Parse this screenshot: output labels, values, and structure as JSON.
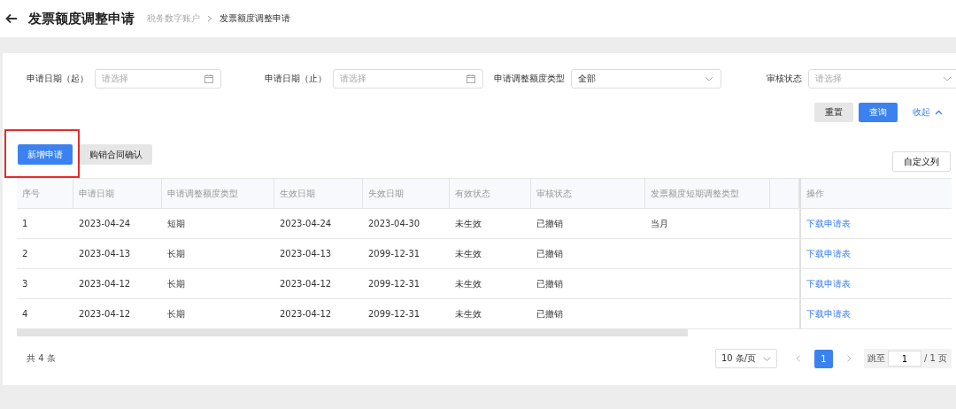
{
  "header": {
    "title": "发票额度调整申请",
    "breadcrumb": [
      {
        "label": "税务数字账户",
        "current": false
      },
      {
        "label": "发票额度调整申请",
        "current": true
      }
    ]
  },
  "filters": [
    {
      "kind": "date",
      "label": "申请日期（起）",
      "placeholder": "请选择"
    },
    {
      "kind": "date",
      "label": "申请日期（止）",
      "placeholder": "请选择"
    },
    {
      "kind": "select",
      "label": "申请调整额度类型",
      "value": "全部"
    },
    {
      "kind": "select",
      "label": "审核状态",
      "placeholder": "请选择"
    }
  ],
  "filter_actions": {
    "reset": "重置",
    "query": "查询",
    "collapse": "收起"
  },
  "toolbar": {
    "buttons": [
      {
        "label": "新增申请",
        "kind": "primary",
        "highlighted": true
      },
      {
        "label": "购销合同确认",
        "kind": "default",
        "highlighted": false
      }
    ],
    "customize": "自定义列"
  },
  "table": {
    "columns": [
      {
        "label": "序号"
      },
      {
        "label": "申请日期"
      },
      {
        "label": "申请调整额度类型"
      },
      {
        "label": "生效日期"
      },
      {
        "label": "失效日期"
      },
      {
        "label": "有效状态"
      },
      {
        "label": "审核状态"
      },
      {
        "label": "发票额度短期调整类型"
      },
      {
        "kind": "spacer"
      },
      {
        "label": "操作"
      }
    ],
    "rows": [
      {
        "no": "1",
        "apply_date": "2023-04-24",
        "type": "短期",
        "start": "2023-04-24",
        "end": "2023-04-30",
        "validity": "未生效",
        "review": "已撤销",
        "short_type": "当月",
        "action": "下载申请表"
      },
      {
        "no": "2",
        "apply_date": "2023-04-13",
        "type": "长期",
        "start": "2023-04-13",
        "end": "2099-12-31",
        "validity": "未生效",
        "review": "已撤销",
        "action": "下载申请表"
      },
      {
        "no": "3",
        "apply_date": "2023-04-12",
        "type": "长期",
        "start": "2023-04-12",
        "end": "2099-12-31",
        "validity": "未生效",
        "review": "已撤销",
        "action": "下载申请表"
      },
      {
        "no": "4",
        "apply_date": "2023-04-12",
        "type": "长期",
        "start": "2023-04-12",
        "end": "2099-12-31",
        "validity": "未生效",
        "review": "已撤销",
        "action": "下载申请表"
      }
    ]
  },
  "pagination": {
    "total": "共 4 条",
    "page_size": "10 条/页",
    "pages": [
      {
        "label": "1",
        "selected": true
      }
    ],
    "jump_label": "跳至",
    "jump_value": "1",
    "page_count": "/ 1 页"
  }
}
